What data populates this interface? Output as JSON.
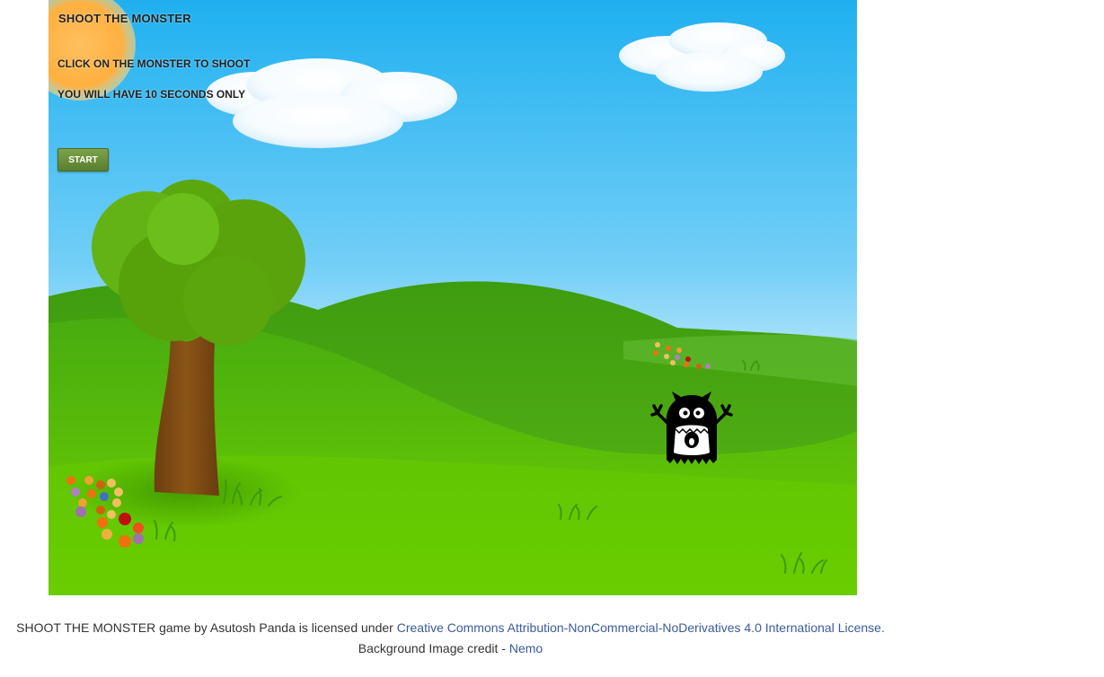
{
  "game": {
    "title": "SHOOT THE MONSTER",
    "instruction": "CLICK ON THE MONSTER TO SHOOT",
    "time_limit": "YOU WILL HAVE 10 SECONDS ONLY",
    "start_label": "START",
    "monster_icon": "monster-icon"
  },
  "footer": {
    "license_prefix": "SHOOT THE MONSTER game by Asutosh Panda is licensed under ",
    "license_link": "Creative Commons Attribution-NonCommercial-NoDerivatives 4.0 International License.",
    "credit_prefix": "Background Image credit - ",
    "credit_link": "Nemo"
  },
  "colors": {
    "sky_top": "#1fb2f0",
    "sky_bottom": "#bfe8fa",
    "grass": "#5cc300",
    "button": "#6b8f3a",
    "link": "#3b5b9a"
  }
}
